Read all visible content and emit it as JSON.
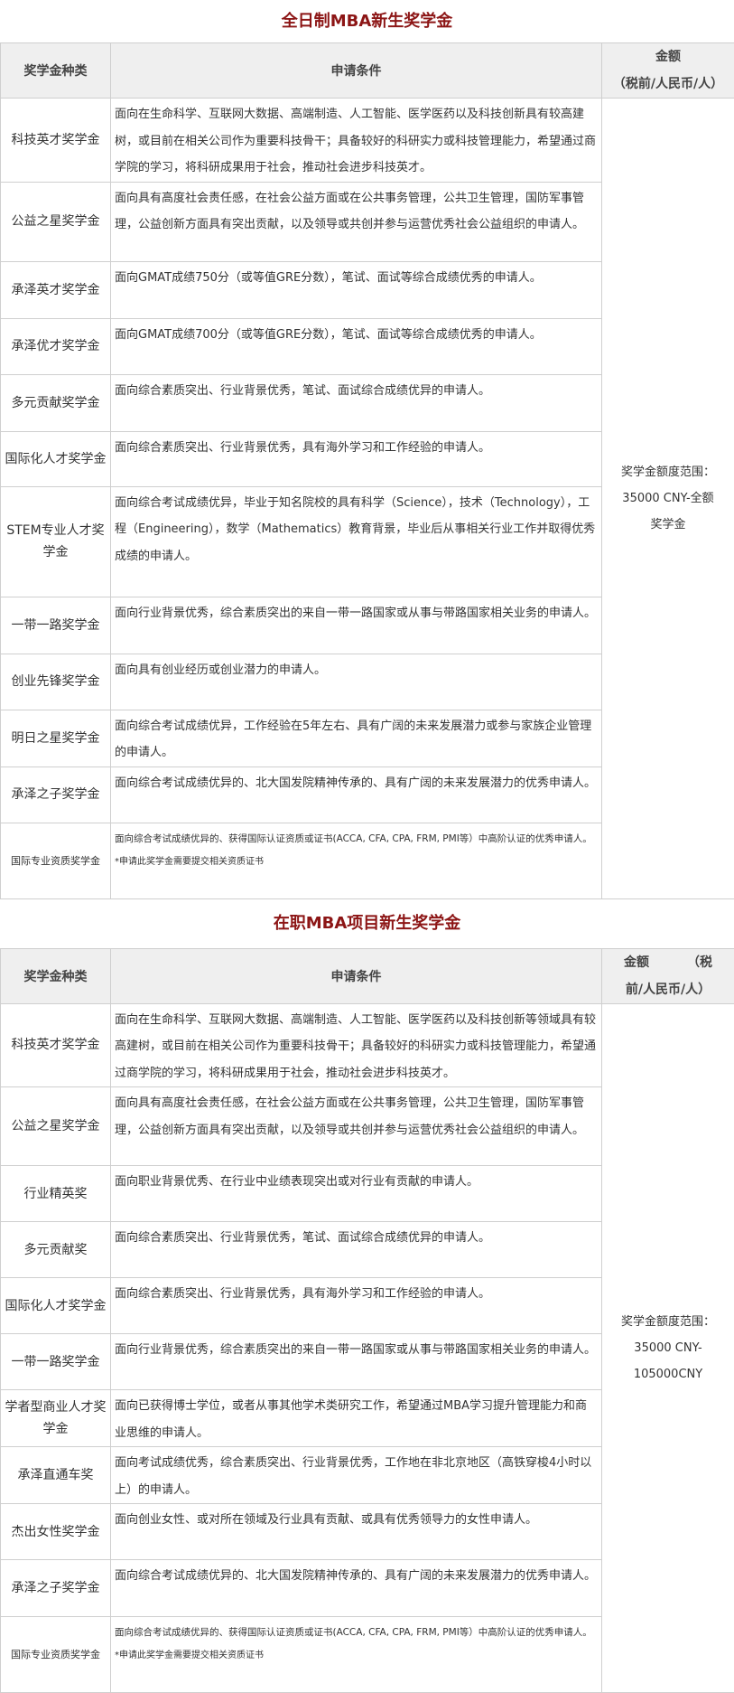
{
  "fulltime": {
    "title": "全日制MBA新生奖学金",
    "headers": {
      "type": "奖学金种类",
      "condition": "申请条件",
      "amount_line1": "金额",
      "amount_line2": "（税前/人民币/人）"
    },
    "amount": "奖学金额度范围：35000 CNY-全额奖学金",
    "rows": [
      {
        "name": "科技英才奖学金",
        "desc": "面向在生命科学、互联网大数据、高端制造、人工智能、医学医药以及科技创新具有较高建树，或目前在相关公司作为重要科技骨干；具备较好的科研实力或科技管理能力，希望通过商学院的学习，将科研成果用于社会，推动社会进步科技英才。"
      },
      {
        "name": "公益之星奖学金",
        "desc": "面向具有高度社会责任感，在社会公益方面或在公共事务管理，公共卫生管理，国防军事管理，公益创新方面具有突出贡献，以及领导或共创并参与运营优秀社会公益组织的申请人。"
      },
      {
        "name": "承泽英才奖学金",
        "desc": "面向GMAT成绩750分（或等值GRE分数），笔试、面试等综合成绩优秀的申请人。"
      },
      {
        "name": "承泽优才奖学金",
        "desc": "面向GMAT成绩700分（或等值GRE分数），笔试、面试等综合成绩优秀的申请人。"
      },
      {
        "name": "多元贡献奖学金",
        "desc": "面向综合素质突出、行业背景优秀，笔试、面试综合成绩优异的申请人。"
      },
      {
        "name": "国际化人才奖学金",
        "desc": "面向综合素质突出、行业背景优秀，具有海外学习和工作经验的申请人。"
      },
      {
        "name": "STEM专业人才奖学金",
        "desc": "面向综合考试成绩优异，毕业于知名院校的具有科学（Science），技术（Technology），工程（Engineering），数学（Mathematics）教育背景，毕业后从事相关行业工作并取得优秀成绩的申请人。"
      },
      {
        "name": "一带一路奖学金",
        "desc": "面向行业背景优秀，综合素质突出的来自一带一路国家或从事与带路国家相关业务的申请人。"
      },
      {
        "name": "创业先锋奖学金",
        "desc": "面向具有创业经历或创业潜力的申请人。"
      },
      {
        "name": "明日之星奖学金",
        "desc": "面向综合考试成绩优异，工作经验在5年左右、具有广阔的未来发展潜力或参与家族企业管理的申请人。"
      },
      {
        "name": "承泽之子奖学金",
        "desc": "面向综合考试成绩优异的、北大国发院精神传承的、具有广阔的未来发展潜力的优秀申请人。"
      },
      {
        "name": "国际专业资质奖学金",
        "desc": "面向综合考试成绩优异的、获得国际认证资质或证书(ACCA, CFA, CPA, FRM, PMI等）中高阶认证的优秀申请人。",
        "note": "*申请此奖学金需要提交相关资质证书"
      }
    ]
  },
  "parttime": {
    "title": "在职MBA项目新生奖学金",
    "headers": {
      "type": "奖学金种类",
      "condition": "申请条件",
      "amount_line1": "金额",
      "amount_line1b": "（税",
      "amount_line2": "前/人民币/人）"
    },
    "amount": "奖学金额度范围：35000 CNY-105000CNY",
    "rows": [
      {
        "name": "科技英才奖学金",
        "desc": "面向在生命科学、互联网大数据、高端制造、人工智能、医学医药以及科技创新等领域具有较高建树，或目前在相关公司作为重要科技骨干；具备较好的科研实力或科技管理能力，希望通过商学院的学习，将科研成果用于社会，推动社会进步科技英才。"
      },
      {
        "name": "公益之星奖学金",
        "desc": "面向具有高度社会责任感，在社会公益方面或在公共事务管理，公共卫生管理，国防军事管理，公益创新方面具有突出贡献，以及领导或共创并参与运营优秀社会公益组织的申请人。"
      },
      {
        "name": "行业精英奖",
        "desc": "面向职业背景优秀、在行业中业绩表现突出或对行业有贡献的申请人。"
      },
      {
        "name": "多元贡献奖",
        "desc": "面向综合素质突出、行业背景优秀，笔试、面试综合成绩优异的申请人。"
      },
      {
        "name": "国际化人才奖学金",
        "desc": "面向综合素质突出、行业背景优秀，具有海外学习和工作经验的申请人。"
      },
      {
        "name": "一带一路奖学金",
        "desc": "面向行业背景优秀，综合素质突出的来自一带一路国家或从事与带路国家相关业务的申请人。"
      },
      {
        "name": "学者型商业人才奖学金",
        "desc": "面向已获得博士学位，或者从事其他学术类研究工作，希望通过MBA学习提升管理能力和商业思维的申请人。"
      },
      {
        "name": "承泽直通车奖",
        "desc": "面向考试成绩优秀，综合素质突出、行业背景优秀，工作地在非北京地区（高铁穿梭4小时以上）的申请人。"
      },
      {
        "name": "杰出女性奖学金",
        "desc": "面向创业女性、或对所在领域及行业具有贡献、或具有优秀领导力的女性申请人。"
      },
      {
        "name": "承泽之子奖学金",
        "desc": "面向综合考试成绩优异的、北大国发院精神传承的、具有广阔的未来发展潜力的优秀申请人。"
      },
      {
        "name": "国际专业资质奖学金",
        "desc": "面向综合考试成绩优异的、获得国际认证资质或证书(ACCA, CFA, CPA, FRM, PMI等）中高阶认证的优秀申请人。",
        "note": "*申请此奖学金需要提交相关资质证书"
      }
    ]
  }
}
